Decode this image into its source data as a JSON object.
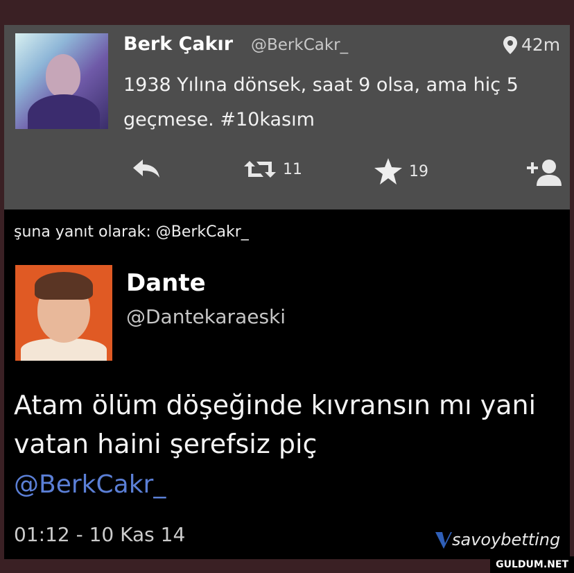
{
  "tweet": {
    "author_name": "Berk Çakır",
    "author_handle": "@BerkCakr_",
    "location_time": "42m",
    "text": "1938 Yılına dönsek, saat 9 olsa, ama hiç 5 geçmese. #10kasım",
    "retweet_count": "11",
    "favorite_count": "19"
  },
  "reply": {
    "in_reply_to": "şuna yanıt olarak: @BerkCakr_",
    "author_name": "Dante",
    "author_handle": "@Dantekaraeski",
    "text": "Atam ölüm döşeğinde kıvransın mı yani vatan haini şerefsiz piç",
    "mention": "@BerkCakr_",
    "timestamp": "01:12 - 10 Kas 14"
  },
  "watermark": {
    "brand": "savoybetting",
    "site": "GULDUM.NET"
  },
  "icons": {
    "location": "map-pin-icon",
    "reply": "reply-arrow-icon",
    "retweet": "retweet-icon",
    "favorite": "star-icon",
    "follow": "add-user-icon"
  }
}
